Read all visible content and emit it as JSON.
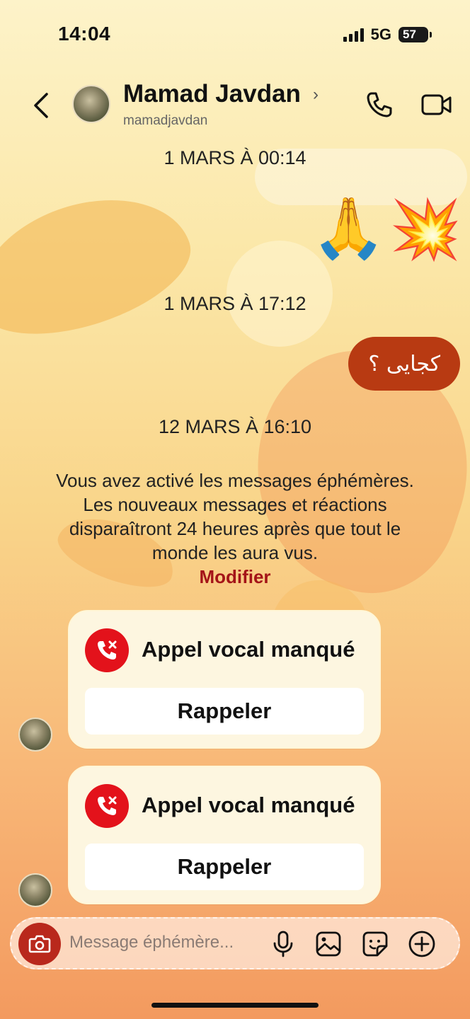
{
  "status_bar": {
    "time": "14:04",
    "network": "5G",
    "battery": "57"
  },
  "header": {
    "name": "Mamad Javdan",
    "username": "mamadjavdan"
  },
  "messages": {
    "date1": "1 MARS À 00:14",
    "emoji1": "🙏",
    "emoji2": "💥",
    "date2": "1 MARS À 17:12",
    "outgoing_text": "کجایی ؟",
    "date3": "12 MARS À 16:10",
    "info": "Vous avez activé les messages éphémères. Les nouveaux messages et réactions disparaîtront 24 heures après que tout le monde les aura vus.",
    "modify_label": "Modifier",
    "calls": [
      {
        "title": "Appel vocal manqué",
        "action": "Rappeler"
      },
      {
        "title": "Appel vocal manqué",
        "action": "Rappeler"
      }
    ]
  },
  "composer": {
    "placeholder": "Message éphémère..."
  },
  "icons": {
    "back": "chevron-left-icon",
    "call": "phone-icon",
    "video": "video-camera-icon",
    "camera": "camera-icon",
    "mic": "microphone-icon",
    "gallery": "image-icon",
    "sticker": "sticker-icon",
    "plus": "plus-circle-icon",
    "missed_call": "missed-call-icon"
  },
  "colors": {
    "accent": "#b83a12",
    "missed_call": "#e3121b",
    "link": "#a41418"
  }
}
